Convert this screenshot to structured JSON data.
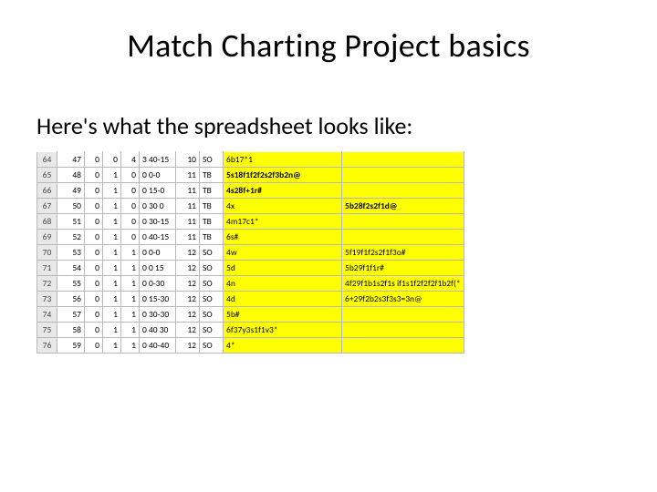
{
  "slide": {
    "title": "Match Charting Project basics",
    "lead": "Here's what the spreadsheet looks like:"
  },
  "sheet": {
    "rows": [
      {
        "rownum": "64",
        "c1": "47",
        "c2": "0",
        "c3": "0",
        "c4": "4",
        "c5": "3 40-15",
        "c6": "10",
        "c7": "SO",
        "c8": "6b17*1",
        "c9": ""
      },
      {
        "rownum": "65",
        "c1": "48",
        "c2": "0",
        "c3": "1",
        "c4": "0",
        "c5": "0 0-0",
        "c6": "11",
        "c7": "TB",
        "c8": "5s18f1f2f2s2f3b2n@",
        "c9": "",
        "bold8": true
      },
      {
        "rownum": "66",
        "c1": "49",
        "c2": "0",
        "c3": "1",
        "c4": "0",
        "c5": "0 15-0",
        "c6": "11",
        "c7": "TB",
        "c8": "4s28f+1r#",
        "c9": "",
        "bold8": true
      },
      {
        "rownum": "67",
        "c1": "50",
        "c2": "0",
        "c3": "1",
        "c4": "0",
        "c5": "0 30 0",
        "c6": "11",
        "c7": "TB",
        "c8": "4x",
        "c9": "5b28f2s2f1d@",
        "bold9": true
      },
      {
        "rownum": "68",
        "c1": "51",
        "c2": "0",
        "c3": "1",
        "c4": "0",
        "c5": "0 30-15",
        "c6": "11",
        "c7": "TB",
        "c8": "4m17c1*",
        "c9": ""
      },
      {
        "rownum": "69",
        "c1": "52",
        "c2": "0",
        "c3": "1",
        "c4": "0",
        "c5": "0 40-15",
        "c6": "11",
        "c7": "TB",
        "c8": "6s#",
        "c9": ""
      },
      {
        "rownum": "70",
        "c1": "53",
        "c2": "0",
        "c3": "1",
        "c4": "1",
        "c5": "0 0-0",
        "c6": "12",
        "c7": "SO",
        "c8": "4w",
        "c9": "5f19f1f2s2f1f3o#"
      },
      {
        "rownum": "71",
        "c1": "54",
        "c2": "0",
        "c3": "1",
        "c4": "1",
        "c5": "0 0 15",
        "c6": "12",
        "c7": "SO",
        "c8": "5d",
        "c9": "5b29f1f1r#"
      },
      {
        "rownum": "72",
        "c1": "55",
        "c2": "0",
        "c3": "1",
        "c4": "1",
        "c5": "0 0-30",
        "c6": "12",
        "c7": "SO",
        "c8": "4n",
        "c9": "4f29f1b1s2f1s if1s1f2f2f2f1b2f(*"
      },
      {
        "rownum": "73",
        "c1": "56",
        "c2": "0",
        "c3": "1",
        "c4": "1",
        "c5": "0 15-30",
        "c6": "12",
        "c7": "SO",
        "c8": "4d",
        "c9": "6+29f2b2s3f3s3=3n@"
      },
      {
        "rownum": "74",
        "c1": "57",
        "c2": "0",
        "c3": "1",
        "c4": "1",
        "c5": "0 30-30",
        "c6": "12",
        "c7": "SO",
        "c8": "5b#",
        "c9": ""
      },
      {
        "rownum": "75",
        "c1": "58",
        "c2": "0",
        "c3": "1",
        "c4": "1",
        "c5": "0 40 30",
        "c6": "12",
        "c7": "SO",
        "c8": "6f37y3s1f1v3*",
        "c9": ""
      },
      {
        "rownum": "76",
        "c1": "59",
        "c2": "0",
        "c3": "1",
        "c4": "1",
        "c5": "0 40-40",
        "c6": "12",
        "c7": "SO",
        "c8": "4*",
        "c9": ""
      }
    ]
  }
}
